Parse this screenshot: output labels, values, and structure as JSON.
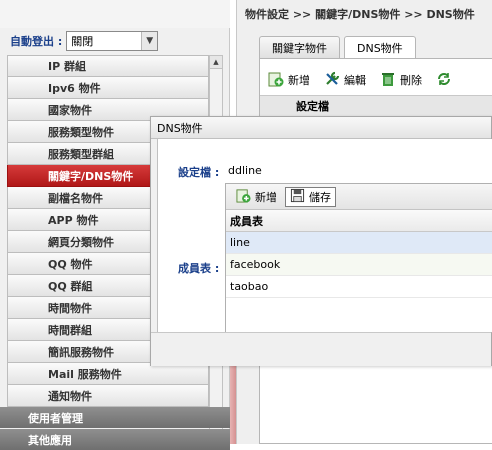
{
  "auto_logout": {
    "label": "自動登出 :",
    "value": "關閉"
  },
  "menu": [
    "IP 群組",
    "Ipv6 物件",
    "國家物件",
    "服務類型物件",
    "服務類型群組",
    "關鍵字/DNS物件",
    "副檔名物件",
    "APP 物件",
    "網頁分類物件",
    "QQ 物件",
    "QQ 群組",
    "時間物件",
    "時間群組",
    "簡訊服務物件",
    "Mail 服務物件",
    "通知物件"
  ],
  "active_menu": "關鍵字/DNS物件",
  "sections": [
    "使用者管理",
    "其他應用"
  ],
  "right_panel": {
    "breadcrumb": "物件設定 >> 關鍵字/DNS物件 >> DNS物件",
    "tabs": [
      "關鍵字物件",
      "DNS物件"
    ],
    "active_tab": "DNS物件",
    "toolbar": {
      "add": "新增",
      "edit": "編輯",
      "delete": "刪除"
    },
    "column_header": "設定檔"
  },
  "modal": {
    "title": "DNS物件",
    "setting_label": "設定檔 :",
    "setting_value": "ddline",
    "member_label": "成員表 :",
    "toolbar": {
      "add": "新增",
      "save": "儲存"
    },
    "table_header": "成員表",
    "members": [
      "line",
      "facebook",
      "taobao"
    ]
  },
  "colors": {
    "active_menu": "#c42222",
    "label_blue": "#1a3f8a",
    "section_gray": "#7d7d7d"
  }
}
